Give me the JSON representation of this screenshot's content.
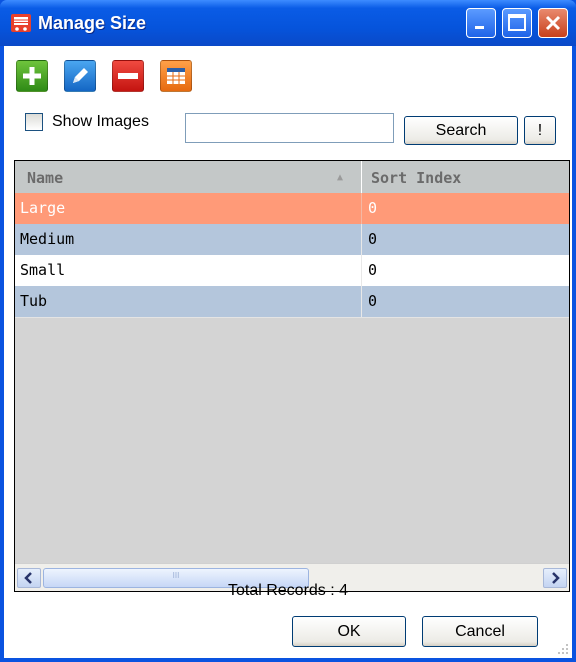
{
  "window": {
    "title": "Manage Size"
  },
  "toolbar": [
    {
      "name": "add-button",
      "color": "#3e9a1d"
    },
    {
      "name": "edit-button",
      "color": "#1c79d0"
    },
    {
      "name": "delete-button",
      "color": "#d6221e"
    },
    {
      "name": "grid-view-button",
      "color": "#ee7a1c"
    }
  ],
  "filters": {
    "show_images_label": "Show Images",
    "show_images_checked": false,
    "search_value": "",
    "search_label": "Search",
    "extra_label": "!"
  },
  "grid": {
    "columns": [
      "Name",
      "Sort Index"
    ],
    "sort_indicator": "▲",
    "rows": [
      {
        "name": "Large",
        "sort_index": "0",
        "selected": true
      },
      {
        "name": "Medium",
        "sort_index": "0",
        "selected": false
      },
      {
        "name": "Small",
        "sort_index": "0",
        "selected": false
      },
      {
        "name": "Tub",
        "sort_index": "0",
        "selected": false
      }
    ],
    "scroll_thumb_glyph": "III"
  },
  "footer": {
    "total_records": "Total Records : 4",
    "ok_label": "OK",
    "cancel_label": "Cancel"
  },
  "colors": {
    "selected_row": "#ff9a78",
    "alt_row": "#b4c6dc",
    "row": "#ffffff"
  }
}
